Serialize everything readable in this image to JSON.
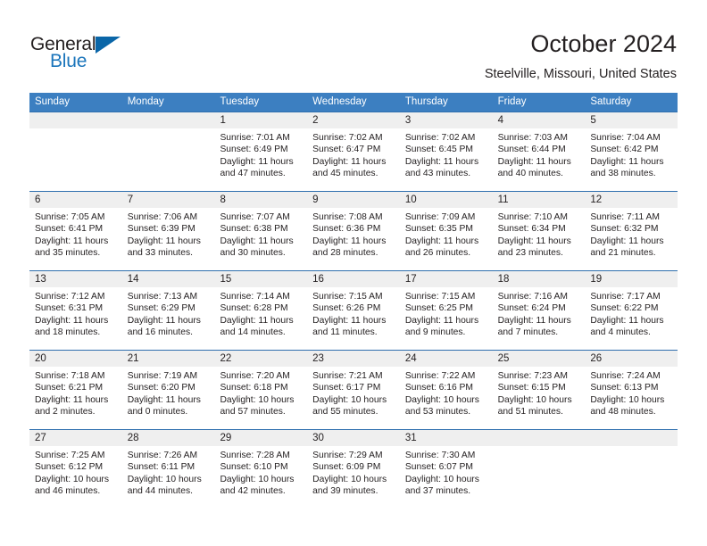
{
  "logo": {
    "word_top": "General",
    "word_bottom": "Blue",
    "accent_color": "#1b75bb",
    "triangle_color": "#0a66a8"
  },
  "header": {
    "title": "October 2024",
    "subtitle": "Steelville, Missouri, United States"
  },
  "theme": {
    "header_row_bg": "#3c7fc1",
    "row_border": "#2f6fae",
    "date_band_bg": "#efefef",
    "text": "#231f20"
  },
  "weekdays": [
    "Sunday",
    "Monday",
    "Tuesday",
    "Wednesday",
    "Thursday",
    "Friday",
    "Saturday"
  ],
  "weeks": [
    [
      {
        "day": "",
        "sunrise": "",
        "sunset": "",
        "daylight_1": "",
        "daylight_2": ""
      },
      {
        "day": "",
        "sunrise": "",
        "sunset": "",
        "daylight_1": "",
        "daylight_2": ""
      },
      {
        "day": "1",
        "sunrise": "Sunrise: 7:01 AM",
        "sunset": "Sunset: 6:49 PM",
        "daylight_1": "Daylight: 11 hours",
        "daylight_2": "and 47 minutes."
      },
      {
        "day": "2",
        "sunrise": "Sunrise: 7:02 AM",
        "sunset": "Sunset: 6:47 PM",
        "daylight_1": "Daylight: 11 hours",
        "daylight_2": "and 45 minutes."
      },
      {
        "day": "3",
        "sunrise": "Sunrise: 7:02 AM",
        "sunset": "Sunset: 6:45 PM",
        "daylight_1": "Daylight: 11 hours",
        "daylight_2": "and 43 minutes."
      },
      {
        "day": "4",
        "sunrise": "Sunrise: 7:03 AM",
        "sunset": "Sunset: 6:44 PM",
        "daylight_1": "Daylight: 11 hours",
        "daylight_2": "and 40 minutes."
      },
      {
        "day": "5",
        "sunrise": "Sunrise: 7:04 AM",
        "sunset": "Sunset: 6:42 PM",
        "daylight_1": "Daylight: 11 hours",
        "daylight_2": "and 38 minutes."
      }
    ],
    [
      {
        "day": "6",
        "sunrise": "Sunrise: 7:05 AM",
        "sunset": "Sunset: 6:41 PM",
        "daylight_1": "Daylight: 11 hours",
        "daylight_2": "and 35 minutes."
      },
      {
        "day": "7",
        "sunrise": "Sunrise: 7:06 AM",
        "sunset": "Sunset: 6:39 PM",
        "daylight_1": "Daylight: 11 hours",
        "daylight_2": "and 33 minutes."
      },
      {
        "day": "8",
        "sunrise": "Sunrise: 7:07 AM",
        "sunset": "Sunset: 6:38 PM",
        "daylight_1": "Daylight: 11 hours",
        "daylight_2": "and 30 minutes."
      },
      {
        "day": "9",
        "sunrise": "Sunrise: 7:08 AM",
        "sunset": "Sunset: 6:36 PM",
        "daylight_1": "Daylight: 11 hours",
        "daylight_2": "and 28 minutes."
      },
      {
        "day": "10",
        "sunrise": "Sunrise: 7:09 AM",
        "sunset": "Sunset: 6:35 PM",
        "daylight_1": "Daylight: 11 hours",
        "daylight_2": "and 26 minutes."
      },
      {
        "day": "11",
        "sunrise": "Sunrise: 7:10 AM",
        "sunset": "Sunset: 6:34 PM",
        "daylight_1": "Daylight: 11 hours",
        "daylight_2": "and 23 minutes."
      },
      {
        "day": "12",
        "sunrise": "Sunrise: 7:11 AM",
        "sunset": "Sunset: 6:32 PM",
        "daylight_1": "Daylight: 11 hours",
        "daylight_2": "and 21 minutes."
      }
    ],
    [
      {
        "day": "13",
        "sunrise": "Sunrise: 7:12 AM",
        "sunset": "Sunset: 6:31 PM",
        "daylight_1": "Daylight: 11 hours",
        "daylight_2": "and 18 minutes."
      },
      {
        "day": "14",
        "sunrise": "Sunrise: 7:13 AM",
        "sunset": "Sunset: 6:29 PM",
        "daylight_1": "Daylight: 11 hours",
        "daylight_2": "and 16 minutes."
      },
      {
        "day": "15",
        "sunrise": "Sunrise: 7:14 AM",
        "sunset": "Sunset: 6:28 PM",
        "daylight_1": "Daylight: 11 hours",
        "daylight_2": "and 14 minutes."
      },
      {
        "day": "16",
        "sunrise": "Sunrise: 7:15 AM",
        "sunset": "Sunset: 6:26 PM",
        "daylight_1": "Daylight: 11 hours",
        "daylight_2": "and 11 minutes."
      },
      {
        "day": "17",
        "sunrise": "Sunrise: 7:15 AM",
        "sunset": "Sunset: 6:25 PM",
        "daylight_1": "Daylight: 11 hours",
        "daylight_2": "and 9 minutes."
      },
      {
        "day": "18",
        "sunrise": "Sunrise: 7:16 AM",
        "sunset": "Sunset: 6:24 PM",
        "daylight_1": "Daylight: 11 hours",
        "daylight_2": "and 7 minutes."
      },
      {
        "day": "19",
        "sunrise": "Sunrise: 7:17 AM",
        "sunset": "Sunset: 6:22 PM",
        "daylight_1": "Daylight: 11 hours",
        "daylight_2": "and 4 minutes."
      }
    ],
    [
      {
        "day": "20",
        "sunrise": "Sunrise: 7:18 AM",
        "sunset": "Sunset: 6:21 PM",
        "daylight_1": "Daylight: 11 hours",
        "daylight_2": "and 2 minutes."
      },
      {
        "day": "21",
        "sunrise": "Sunrise: 7:19 AM",
        "sunset": "Sunset: 6:20 PM",
        "daylight_1": "Daylight: 11 hours",
        "daylight_2": "and 0 minutes."
      },
      {
        "day": "22",
        "sunrise": "Sunrise: 7:20 AM",
        "sunset": "Sunset: 6:18 PM",
        "daylight_1": "Daylight: 10 hours",
        "daylight_2": "and 57 minutes."
      },
      {
        "day": "23",
        "sunrise": "Sunrise: 7:21 AM",
        "sunset": "Sunset: 6:17 PM",
        "daylight_1": "Daylight: 10 hours",
        "daylight_2": "and 55 minutes."
      },
      {
        "day": "24",
        "sunrise": "Sunrise: 7:22 AM",
        "sunset": "Sunset: 6:16 PM",
        "daylight_1": "Daylight: 10 hours",
        "daylight_2": "and 53 minutes."
      },
      {
        "day": "25",
        "sunrise": "Sunrise: 7:23 AM",
        "sunset": "Sunset: 6:15 PM",
        "daylight_1": "Daylight: 10 hours",
        "daylight_2": "and 51 minutes."
      },
      {
        "day": "26",
        "sunrise": "Sunrise: 7:24 AM",
        "sunset": "Sunset: 6:13 PM",
        "daylight_1": "Daylight: 10 hours",
        "daylight_2": "and 48 minutes."
      }
    ],
    [
      {
        "day": "27",
        "sunrise": "Sunrise: 7:25 AM",
        "sunset": "Sunset: 6:12 PM",
        "daylight_1": "Daylight: 10 hours",
        "daylight_2": "and 46 minutes."
      },
      {
        "day": "28",
        "sunrise": "Sunrise: 7:26 AM",
        "sunset": "Sunset: 6:11 PM",
        "daylight_1": "Daylight: 10 hours",
        "daylight_2": "and 44 minutes."
      },
      {
        "day": "29",
        "sunrise": "Sunrise: 7:28 AM",
        "sunset": "Sunset: 6:10 PM",
        "daylight_1": "Daylight: 10 hours",
        "daylight_2": "and 42 minutes."
      },
      {
        "day": "30",
        "sunrise": "Sunrise: 7:29 AM",
        "sunset": "Sunset: 6:09 PM",
        "daylight_1": "Daylight: 10 hours",
        "daylight_2": "and 39 minutes."
      },
      {
        "day": "31",
        "sunrise": "Sunrise: 7:30 AM",
        "sunset": "Sunset: 6:07 PM",
        "daylight_1": "Daylight: 10 hours",
        "daylight_2": "and 37 minutes."
      },
      {
        "day": "",
        "sunrise": "",
        "sunset": "",
        "daylight_1": "",
        "daylight_2": ""
      },
      {
        "day": "",
        "sunrise": "",
        "sunset": "",
        "daylight_1": "",
        "daylight_2": ""
      }
    ]
  ]
}
